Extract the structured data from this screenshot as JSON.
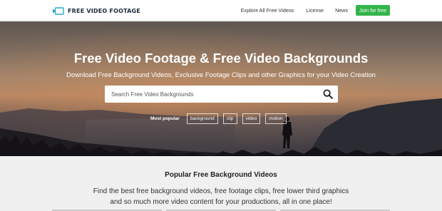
{
  "header": {
    "logo_text": "FREE VIDEO FOOTAGE",
    "nav": [
      "Explore All Free Videos",
      "License",
      "News"
    ],
    "join_label": "Join for free",
    "join_color": "#33b44a",
    "logo_color": "#2aa8c8"
  },
  "hero": {
    "title": "Free Video Footage & Free Video Backgrounds",
    "subtitle": "Download Free Background Videos, Exclusive Footage Clips and other Graphics for your Video Creation",
    "search_placeholder": "Search Free Video Backgrounds",
    "popular_label": "Most popular",
    "tags": [
      "background",
      "clip",
      "video",
      "motion"
    ]
  },
  "section": {
    "title": "Popular Free Background Videos",
    "desc_line1": "Find the best free background videos, free footage clips, free lower third graphics",
    "desc_line2": "and so much more video content for your productions, all in one place!"
  }
}
